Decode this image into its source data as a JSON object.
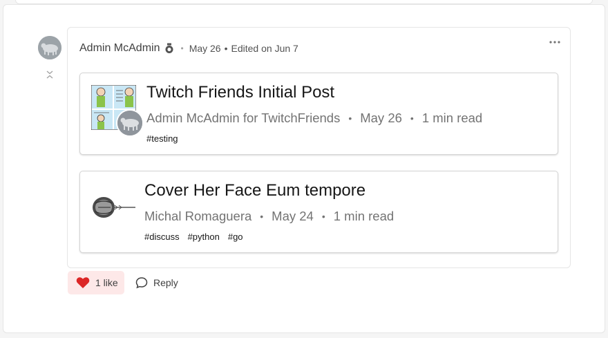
{
  "comment": {
    "author": "Admin McAdmin",
    "date": "May 26",
    "edited": "Edited on Jun 7",
    "separator": "•"
  },
  "embeds": [
    {
      "title": "Twitch Friends Initial Post",
      "author": "Admin McAdmin for TwitchFriends",
      "date": "May 26",
      "read_time": "1 min read",
      "tags": [
        "#testing"
      ]
    },
    {
      "title": "Cover Her Face Eum tempore",
      "author": "Michal Romaguera",
      "date": "May 24",
      "read_time": "1 min read",
      "tags": [
        "#discuss",
        "#python",
        "#go"
      ]
    }
  ],
  "actions": {
    "like_label": "1 like",
    "reply_label": "Reply"
  },
  "icons": {
    "more": "more-horizontal-icon",
    "collapse": "collapse-icon",
    "badge": "medal-icon",
    "like": "heart-icon",
    "reply": "comment-bubble-icon"
  },
  "colors": {
    "heart": "#dc2626",
    "like_bg": "#fde8e8"
  }
}
